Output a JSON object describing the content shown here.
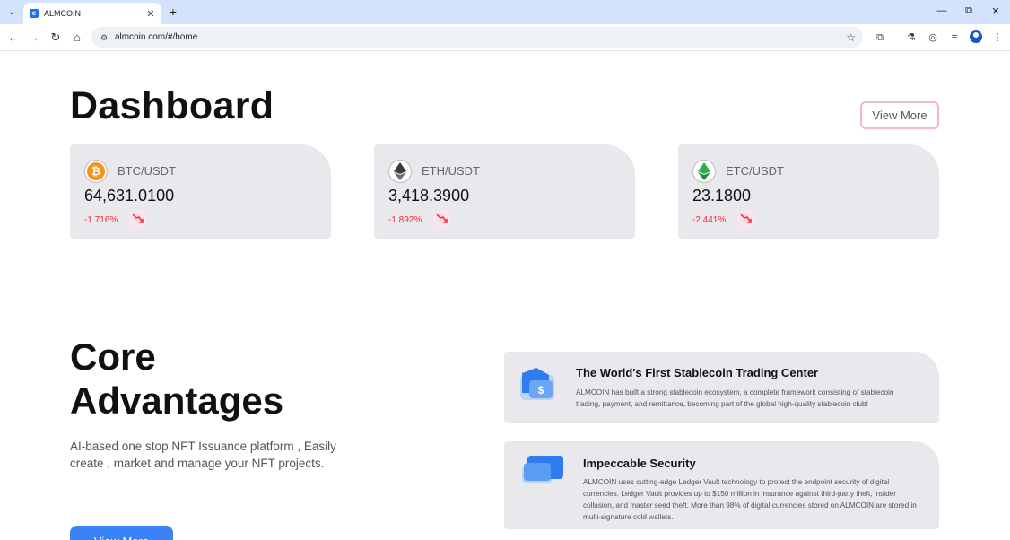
{
  "browser": {
    "tab_title": "ALMCOIN",
    "favicon_letter": "e",
    "url": "almcoin.com/#/home",
    "new_tab": "+",
    "minimize": "—",
    "restore": "⧉",
    "close": "✕"
  },
  "dashboard": {
    "title": "Dashboard",
    "view_more": "View More",
    "tickers": [
      {
        "pair": "BTC/USDT",
        "price": "64,631.0100",
        "change": "-1.716%",
        "icon": "bitcoin-icon",
        "color": "#f7931a",
        "glyph": "₿"
      },
      {
        "pair": "ETH/USDT",
        "price": "3,418.3900",
        "change": "-1.892%",
        "icon": "ethereum-icon",
        "color": "#3c3c3d",
        "glyph": ""
      },
      {
        "pair": "ETC/USDT",
        "price": "23.1800",
        "change": "-2.441%",
        "icon": "ethereum-classic-icon",
        "color": "#28b446",
        "glyph": ""
      }
    ],
    "down_color": "#ef2b3c"
  },
  "core": {
    "title_line1": "Core",
    "title_line2": "Advantages",
    "subtitle": "AI-based one stop NFT Issuance platform , Easily create , market and manage your NFT projects.",
    "view_more": "View More",
    "features": [
      {
        "title": "The World's First Stablecoin Trading Center",
        "desc": "ALMCOIN has built a strong stablecoin ecosystem, a complete framework consisting of stablecoin trading, payment, and remittance, becoming part of the global high-quality stablecoin club!",
        "icon": "wallet-dollar-icon"
      },
      {
        "title": "Impeccable Security",
        "desc": "ALMCOIN uses cutting-edge Ledger Vault technology to protect the endpoint security of digital currencies. Ledger Vault provides up to $150 million in insurance against third-party theft, insider collusion, and master seed theft. More than 98% of digital currencies stored on ALMCOIN are stored in multi-signature cold wallets.",
        "icon": "secure-card-icon"
      }
    ]
  },
  "accent_color": "#3b82f6"
}
